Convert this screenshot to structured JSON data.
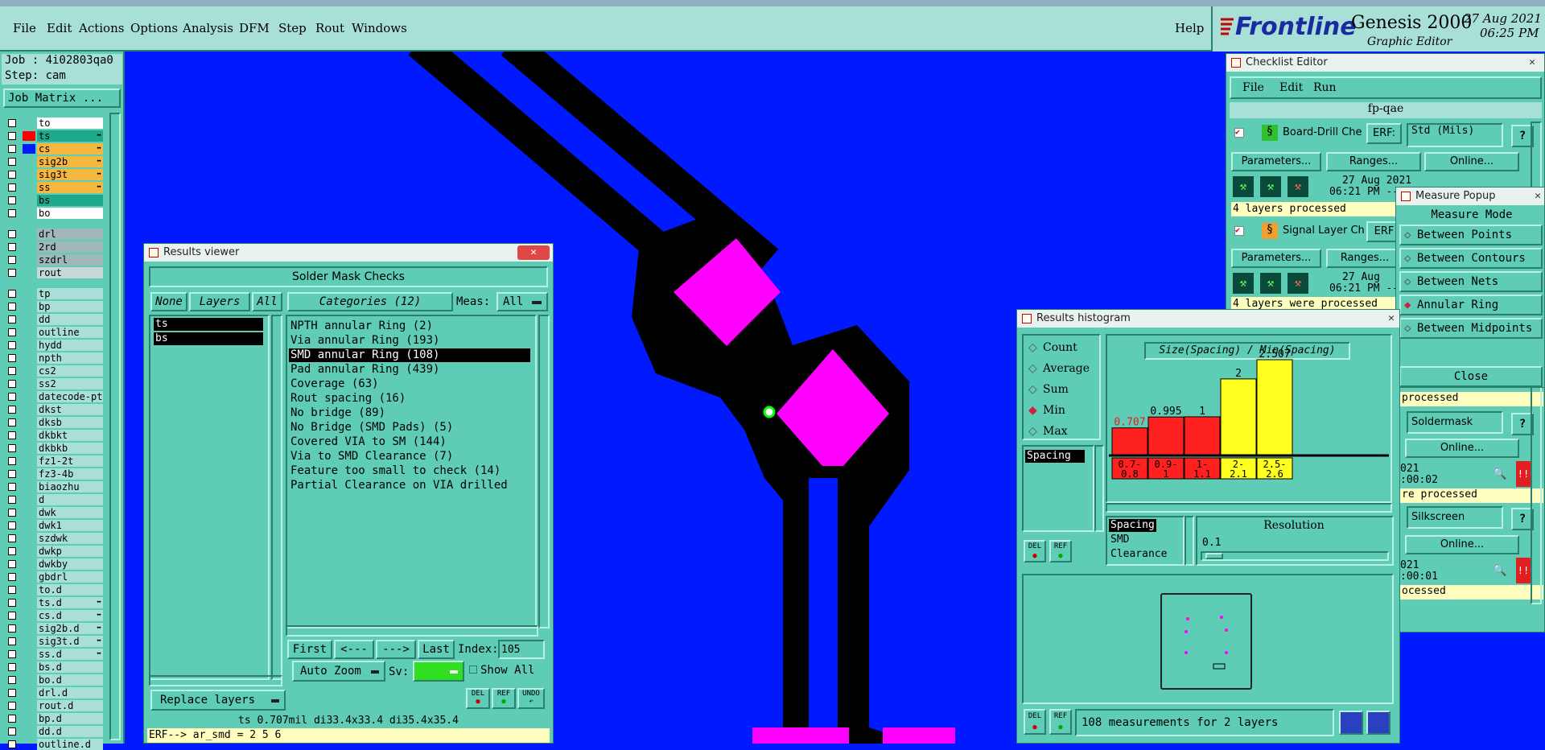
{
  "menu": {
    "file": "File",
    "edit": "Edit",
    "actions": "Actions",
    "options": "Options",
    "analysis": "Analysis",
    "dfm": "DFM",
    "step": "Step",
    "rout": "Rout",
    "windows": "Windows",
    "help": "Help"
  },
  "brand": {
    "logo": "Frontline",
    "product": "Genesis 2000",
    "subtitle": "Graphic Editor",
    "date": "27 Aug 2021",
    "time": "06:25 PM"
  },
  "job": {
    "job_label": "Job : 4i02803qa0",
    "step_label": "Step: cam",
    "matrix_button": "Job Matrix ..."
  },
  "layers": [
    {
      "name": "to",
      "color": "#ffffff",
      "swatch": ""
    },
    {
      "name": "ts",
      "color": "#1fa88a",
      "swatch": "#ff0000",
      "edit": "⬌"
    },
    {
      "name": "cs",
      "color": "#f5b740",
      "swatch": "#0019ff",
      "edit": "⬌"
    },
    {
      "name": "sig2b",
      "color": "#f5b740",
      "swatch": "",
      "edit": "⬌"
    },
    {
      "name": "sig3t",
      "color": "#f5b740",
      "swatch": "",
      "edit": "⬌"
    },
    {
      "name": "ss",
      "color": "#f5b740",
      "swatch": "",
      "edit": "⬌"
    },
    {
      "name": "bs",
      "color": "#1fa88a",
      "swatch": ""
    },
    {
      "name": "bo",
      "color": "#ffffff",
      "swatch": ""
    },
    {
      "name": "drl",
      "color": "#a0b8b8",
      "swatch": ""
    },
    {
      "name": "2rd",
      "color": "#a0b8b8",
      "swatch": ""
    },
    {
      "name": "szdrl",
      "color": "#a0b8b8",
      "swatch": ""
    },
    {
      "name": "rout",
      "color": "#c8d8d8",
      "swatch": ""
    },
    {
      "name": "tp",
      "color": "#a8e0d8",
      "swatch": ""
    },
    {
      "name": "bp",
      "color": "#a8e0d8",
      "swatch": ""
    },
    {
      "name": "dd",
      "color": "#a8e0d8",
      "swatch": ""
    },
    {
      "name": "outline",
      "color": "#a8e0d8",
      "swatch": ""
    },
    {
      "name": "hydd",
      "color": "#a8e0d8",
      "swatch": ""
    },
    {
      "name": "npth",
      "color": "#a8e0d8",
      "swatch": ""
    },
    {
      "name": "cs2",
      "color": "#a8e0d8",
      "swatch": ""
    },
    {
      "name": "ss2",
      "color": "#a8e0d8",
      "swatch": ""
    },
    {
      "name": "datecode-pte",
      "color": "#a8e0d8",
      "swatch": ""
    },
    {
      "name": "dkst",
      "color": "#a8e0d8",
      "swatch": ""
    },
    {
      "name": "dksb",
      "color": "#a8e0d8",
      "swatch": ""
    },
    {
      "name": "dkbkt",
      "color": "#a8e0d8",
      "swatch": ""
    },
    {
      "name": "dkbkb",
      "color": "#a8e0d8",
      "swatch": ""
    },
    {
      "name": "fz1-2t",
      "color": "#a8e0d8",
      "swatch": ""
    },
    {
      "name": "fz3-4b",
      "color": "#a8e0d8",
      "swatch": ""
    },
    {
      "name": "biaozhu",
      "color": "#a8e0d8",
      "swatch": ""
    },
    {
      "name": "d",
      "color": "#a8e0d8",
      "swatch": ""
    },
    {
      "name": "dwk",
      "color": "#a8e0d8",
      "swatch": ""
    },
    {
      "name": "dwk1",
      "color": "#a8e0d8",
      "swatch": ""
    },
    {
      "name": "szdwk",
      "color": "#a8e0d8",
      "swatch": ""
    },
    {
      "name": "dwkp",
      "color": "#a8e0d8",
      "swatch": ""
    },
    {
      "name": "dwkby",
      "color": "#a8e0d8",
      "swatch": ""
    },
    {
      "name": "gbdrl",
      "color": "#a8e0d8",
      "swatch": ""
    },
    {
      "name": "to.d",
      "color": "#a8e0d8",
      "swatch": ""
    },
    {
      "name": "ts.d",
      "color": "#a8e0d8",
      "swatch": "",
      "edit": "⬌"
    },
    {
      "name": "cs.d",
      "color": "#a8e0d8",
      "swatch": "",
      "edit": "⬌"
    },
    {
      "name": "sig2b.d",
      "color": "#a8e0d8",
      "swatch": "",
      "edit": "⬌"
    },
    {
      "name": "sig3t.d",
      "color": "#a8e0d8",
      "swatch": "",
      "edit": "⬌"
    },
    {
      "name": "ss.d",
      "color": "#a8e0d8",
      "swatch": "",
      "edit": "⬌"
    },
    {
      "name": "bs.d",
      "color": "#a8e0d8",
      "swatch": ""
    },
    {
      "name": "bo.d",
      "color": "#a8e0d8",
      "swatch": ""
    },
    {
      "name": "drl.d",
      "color": "#a8e0d8",
      "swatch": ""
    },
    {
      "name": "rout.d",
      "color": "#a8e0d8",
      "swatch": ""
    },
    {
      "name": "bp.d",
      "color": "#a8e0d8",
      "swatch": ""
    },
    {
      "name": "dd.d",
      "color": "#a8e0d8",
      "swatch": ""
    },
    {
      "name": "outline.d",
      "color": "#a8e0d8",
      "swatch": ""
    }
  ],
  "results_viewer": {
    "title": "Results viewer",
    "header": "Solder Mask Checks",
    "none": "None",
    "layers": "Layers",
    "all": "All",
    "categories_btn": "Categories (12)",
    "meas_label": "Meas:",
    "meas_value": "All",
    "layer_list": [
      "ts",
      "bs"
    ],
    "categories": [
      "NPTH annular Ring (2)",
      "Via annular Ring (193)",
      "SMD annular Ring (108)",
      "Pad annular Ring (439)",
      "Coverage (63)",
      "Rout spacing (16)",
      "No bridge (89)",
      "No Bridge (SMD Pads) (5)",
      "Covered VIA to SM (144)",
      "Via to SMD Clearance (7)",
      "Feature too small to check (14)",
      "Partial Clearance on VIA drilled"
    ],
    "selected_category": 2,
    "first": "First",
    "prev": "<---",
    "next": "--->",
    "last": "Last",
    "index_label": "Index:",
    "index_value": "105",
    "auto_zoom": "Auto Zoom",
    "sv": "Sv:",
    "show_all": "Show All",
    "replace_layers": "Replace layers",
    "del": "DEL",
    "ref": "REF",
    "undo": "UNDO",
    "status": "ts 0.707mil  di33.4x33.4  di35.4x35.4",
    "erf": "ERF--> ar_smd = 2 5 6"
  },
  "checklist": {
    "title": "Checklist Editor",
    "menu_file": "File",
    "menu_edit": "Edit",
    "menu_run": "Run",
    "name": "fp-qae",
    "erf_label": "ERF:",
    "erf_value": "Std (Mils)",
    "parameters": "Parameters...",
    "ranges": "Ranges...",
    "online": "Online...",
    "item1": "Board-Drill Che",
    "item1_date": "27 Aug 2021",
    "item1_time": "06:21 PM --",
    "item1_status": "4 layers processed",
    "item2": "Signal Layer Ch",
    "item2_erf": "ERF",
    "item2_date": "27 Aug",
    "item2_time": "06:21 PM --",
    "item2_status": "4 layers were processed",
    "processed1": "processed",
    "soldermask": "Soldermask",
    "date3": "021",
    "time3": ":00:02",
    "processed2": "re processed",
    "silkscreen": "Silkscreen",
    "date4": "021",
    "time4": ":00:01",
    "processed3": "ocessed",
    "alert": "!!"
  },
  "measure": {
    "title": "Measure Popup",
    "mode": "Measure Mode",
    "options": [
      "Between Points",
      "Between Contours",
      "Between Nets",
      "Annular Ring",
      "Between Midpoints"
    ],
    "selected": 3,
    "close": "Close"
  },
  "histogram": {
    "title": "Results histogram",
    "stats": [
      "Count",
      "Average",
      "Sum",
      "Min",
      "Max"
    ],
    "selected_stat": 3,
    "list_item": "Spacing",
    "chart_title": "Size(Spacing) / Min(Spacing)",
    "field_list": [
      "Spacing",
      "SMD",
      "Clearance"
    ],
    "resolution_label": "Resolution",
    "resolution_value": "0.1",
    "summary": "108 measurements for 2 layers",
    "del": "DEL",
    "ref": "REF"
  },
  "chart_data": {
    "type": "bar",
    "title": "Size(Spacing) / Min(Spacing)",
    "categories": [
      "0.7-\n0.8",
      "0.9-\n1",
      "1-\n1.1",
      "2-\n2.1",
      "2.5-\n2.6"
    ],
    "values": [
      0.707,
      0.995,
      1,
      2,
      2.507
    ],
    "value_labels": [
      "0.707",
      "0.995",
      "1",
      "2",
      "2.507"
    ],
    "colors": [
      "#ff2020",
      "#ff2020",
      "#ff2020",
      "#ffff20",
      "#ffff20"
    ]
  }
}
